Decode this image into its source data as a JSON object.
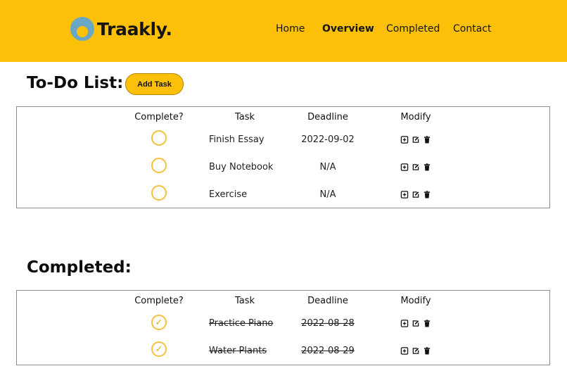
{
  "brand": {
    "name": "Traakly.",
    "logo_icon": "traakly-logo-icon"
  },
  "nav": [
    {
      "label": "Home",
      "active": false
    },
    {
      "label": "Overview",
      "active": true
    },
    {
      "label": "Completed",
      "active": false
    },
    {
      "label": "Contact",
      "active": false
    }
  ],
  "todo": {
    "title": "To-Do List:",
    "add_button": "Add Task",
    "headers": {
      "complete": "Complete?",
      "task": "Task",
      "deadline": "Deadline",
      "modify": "Modify"
    },
    "rows": [
      {
        "task": "Finish Essay",
        "deadline": "2022-09-02",
        "complete": false
      },
      {
        "task": "Buy Notebook",
        "deadline": "N/A",
        "complete": false
      },
      {
        "task": "Exercise",
        "deadline": "N/A",
        "complete": false
      }
    ]
  },
  "completed": {
    "title": "Completed:",
    "headers": {
      "complete": "Complete?",
      "task": "Task",
      "deadline": "Deadline",
      "modify": "Modify"
    },
    "rows": [
      {
        "task": "Practice Piano",
        "deadline": "2022-08-28",
        "complete": true
      },
      {
        "task": "Water Plants",
        "deadline": "2022-08-29",
        "complete": true
      }
    ]
  },
  "icons": {
    "check": "✓",
    "modify": [
      "plus-square-icon",
      "edit-icon",
      "trash-icon"
    ]
  },
  "colors": {
    "header_bg": "#fdc008",
    "accent": "#f6c23e",
    "logo_circle": "#6aa7c4"
  }
}
